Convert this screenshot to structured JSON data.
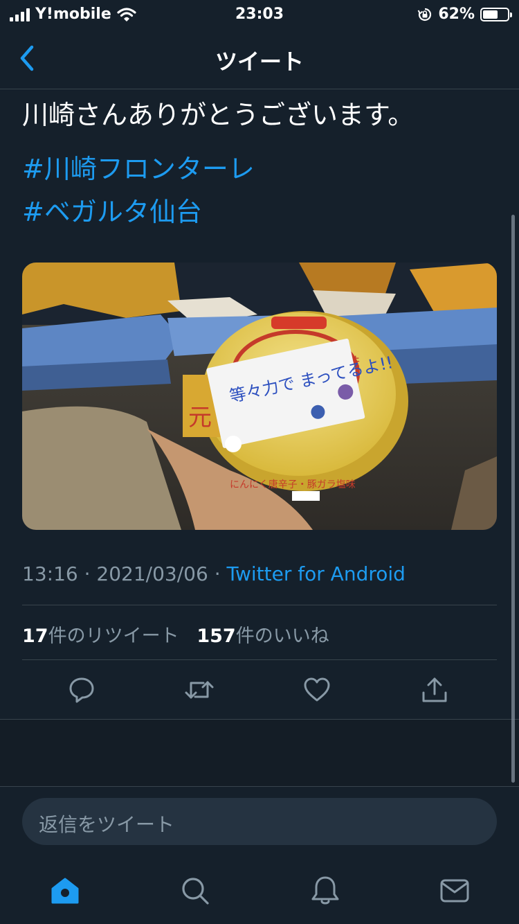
{
  "status_bar": {
    "carrier": "Y!mobile",
    "time": "23:03",
    "battery": "62%"
  },
  "nav": {
    "title": "ツイート"
  },
  "tweet": {
    "text": "川崎さんありがとうございます。",
    "hashtags": [
      "#川崎フロンターレ",
      "#ベガルタ仙台"
    ],
    "image_note": "等々力で まってるよ!!",
    "time": "13:16",
    "date": "2021/03/06",
    "separator": "·",
    "source": "Twitter for Android",
    "retweet_count": "17",
    "retweet_label": "件のリツイート",
    "like_count": "157",
    "like_label": "件のいいね"
  },
  "reply_box": {
    "placeholder": "返信をツイート"
  },
  "tabbar": {
    "items": [
      "home-icon",
      "search-icon",
      "notifications-icon",
      "messages-icon"
    ]
  },
  "colors": {
    "background": "#15202b",
    "accent": "#1d9bf0",
    "muted": "#8899a6",
    "divider": "#38444d"
  }
}
